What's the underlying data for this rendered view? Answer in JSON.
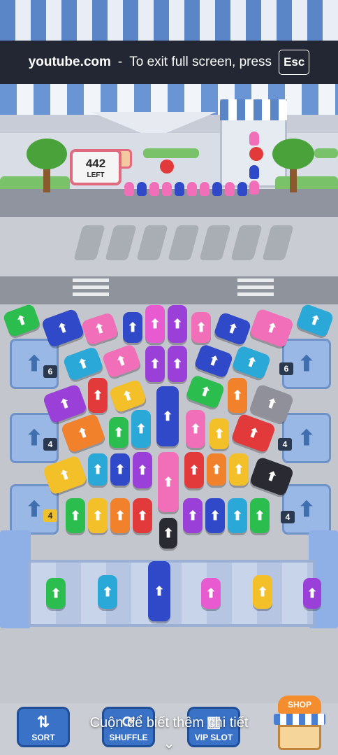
{
  "fullscreen_bar": {
    "site": "youtube.com",
    "separator": "-",
    "message": "To exit full screen, press",
    "key": "Esc"
  },
  "counter": {
    "value": "442",
    "label": "LEFT"
  },
  "ramps": {
    "left_top": "6",
    "right_top": "6",
    "left_mid": "4",
    "right_mid": "4",
    "left_bottom": "4",
    "right_bottom": "4"
  },
  "buttons": {
    "sort": "SORT",
    "shuffle": "SHUFFLE",
    "vip_slot": "VIP SLOT",
    "shop": "SHOP"
  },
  "overlay": {
    "scroll_hint": "Cuộn để biết thêm chi tiết",
    "chevron": "⌄"
  },
  "colors": {
    "green": "#2bbd4e",
    "blue": "#2f49c8",
    "pink": "#f06fb8",
    "purple": "#9a3fd8",
    "red": "#e23a3a",
    "yellow": "#f3c02a",
    "orange": "#f2812b",
    "teal": "#2aa8d8",
    "gray": "#8f9099",
    "black": "#2a2a33",
    "magenta": "#e85ad0"
  },
  "icons": {
    "arrow": "⬆",
    "sort": "⇅",
    "shuffle": "⟳",
    "vip": "▦"
  }
}
